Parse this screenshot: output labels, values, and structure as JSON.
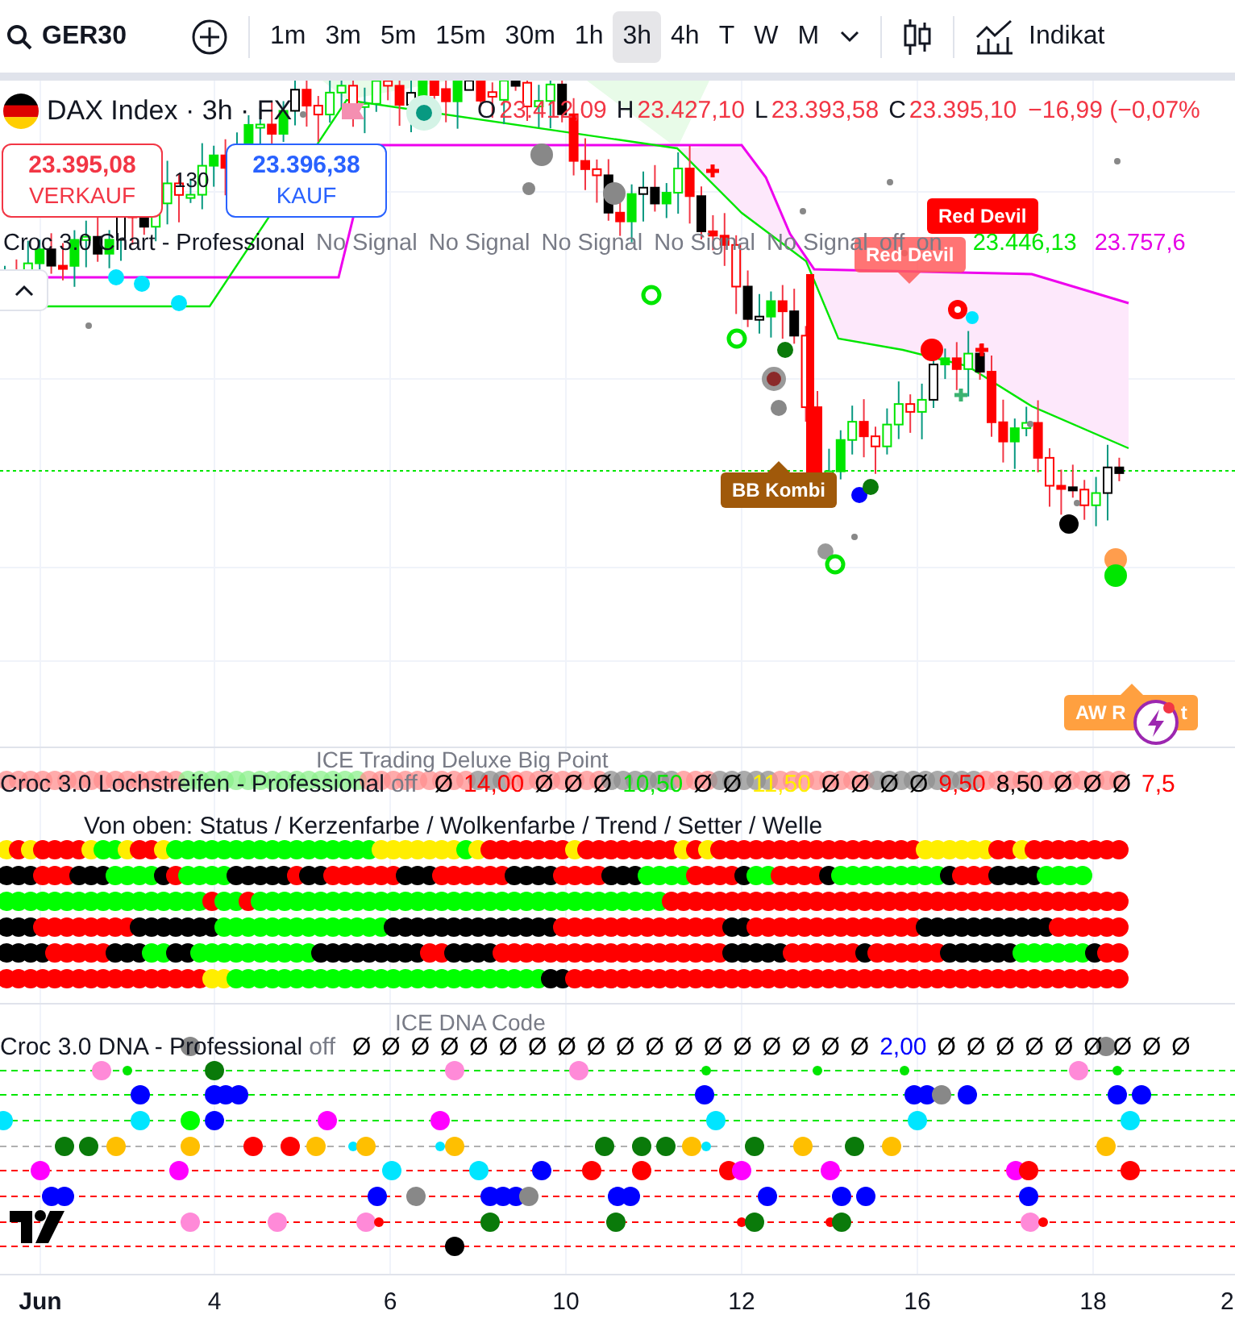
{
  "toolbar": {
    "symbol": "GER30",
    "intervals": [
      {
        "label": "1m",
        "selected": false
      },
      {
        "label": "3m",
        "selected": false
      },
      {
        "label": "5m",
        "selected": false
      },
      {
        "label": "15m",
        "selected": false
      },
      {
        "label": "30m",
        "selected": false
      },
      {
        "label": "1h",
        "selected": false
      },
      {
        "label": "3h",
        "selected": true
      },
      {
        "label": "4h",
        "selected": false
      },
      {
        "label": "T",
        "selected": false
      },
      {
        "label": "W",
        "selected": false
      },
      {
        "label": "M",
        "selected": false
      }
    ],
    "indicators_label": "Indikat"
  },
  "legend": {
    "title": "DAX Index · 3h · FX",
    "ohlc": [
      {
        "key": "O",
        "value": "23.412,09"
      },
      {
        "key": "H",
        "value": "23.427,10"
      },
      {
        "key": "L",
        "value": "23.393,58"
      },
      {
        "key": "C",
        "value": "23.395,10"
      }
    ],
    "change": "−16,99 (−0,07%"
  },
  "sell": {
    "price": "23.395,08",
    "label": "VERKAUF"
  },
  "buy": {
    "price": "23.396,38",
    "label": "KAUF"
  },
  "spread": "130",
  "chart_indicator": {
    "name": "Croc 3.0 Chart - Professional",
    "signals": [
      "No Signal",
      "No Signal",
      "No Signal",
      "No Signal",
      "No Signal"
    ],
    "flags": [
      "off",
      "on"
    ],
    "values": [
      {
        "text": "23.446,13",
        "color": "#00e600"
      },
      {
        "text": "23.757,6",
        "color": "#e600e6"
      }
    ]
  },
  "signal_labels": [
    {
      "kind": "solid",
      "text": "Red Devil"
    },
    {
      "kind": "faded",
      "text": "Red Devil"
    },
    {
      "kind": "kombi",
      "text": "BB Kombi"
    },
    {
      "kind": "rocket",
      "text": "AW R",
      "tail": "t"
    }
  ],
  "lochstreifen": {
    "title": "ICE Trading Deluxe Big Point",
    "name": "Croc 3.0 Lochstreifen - Professional",
    "state": "off",
    "values": [
      {
        "text": "Ø",
        "color": "#000000"
      },
      {
        "text": "14,00",
        "color": "#ff0000"
      },
      {
        "text": "Ø",
        "color": "#000000"
      },
      {
        "text": "Ø",
        "color": "#000000"
      },
      {
        "text": "Ø",
        "color": "#000000"
      },
      {
        "text": "10,50",
        "color": "#00e600"
      },
      {
        "text": "Ø",
        "color": "#000000"
      },
      {
        "text": "Ø",
        "color": "#000000"
      },
      {
        "text": "11,50",
        "color": "#ffee00"
      },
      {
        "text": "Ø",
        "color": "#000000"
      },
      {
        "text": "Ø",
        "color": "#000000"
      },
      {
        "text": "Ø",
        "color": "#000000"
      },
      {
        "text": "Ø",
        "color": "#000000"
      },
      {
        "text": "9,50",
        "color": "#ff0000"
      },
      {
        "text": "8,50",
        "color": "#000000"
      },
      {
        "text": "Ø",
        "color": "#000000"
      },
      {
        "text": "Ø",
        "color": "#000000"
      },
      {
        "text": "Ø",
        "color": "#000000"
      },
      {
        "text": "7,5",
        "color": "#ff0000"
      }
    ],
    "legend": "Von oben: Status / Kerzenfarbe / Wolkenfarbe / Trend / Setter / Welle"
  },
  "dna": {
    "title": "ICE DNA Code",
    "name": "Croc 3.0 DNA - Professional",
    "state": "off",
    "values": [
      {
        "text": "Ø",
        "color": "#000000"
      },
      {
        "text": "Ø",
        "color": "#000000"
      },
      {
        "text": "Ø",
        "color": "#000000"
      },
      {
        "text": "Ø",
        "color": "#000000"
      },
      {
        "text": "Ø",
        "color": "#000000"
      },
      {
        "text": "Ø",
        "color": "#000000"
      },
      {
        "text": "Ø",
        "color": "#000000"
      },
      {
        "text": "Ø",
        "color": "#000000"
      },
      {
        "text": "Ø",
        "color": "#000000"
      },
      {
        "text": "Ø",
        "color": "#000000"
      },
      {
        "text": "Ø",
        "color": "#000000"
      },
      {
        "text": "Ø",
        "color": "#000000"
      },
      {
        "text": "Ø",
        "color": "#000000"
      },
      {
        "text": "Ø",
        "color": "#000000"
      },
      {
        "text": "Ø",
        "color": "#000000"
      },
      {
        "text": "Ø",
        "color": "#000000"
      },
      {
        "text": "Ø",
        "color": "#000000"
      },
      {
        "text": "Ø",
        "color": "#000000"
      },
      {
        "text": "2,00",
        "color": "#0000ff"
      },
      {
        "text": "Ø",
        "color": "#000000"
      },
      {
        "text": "Ø",
        "color": "#000000"
      },
      {
        "text": "Ø",
        "color": "#000000"
      },
      {
        "text": "Ø",
        "color": "#000000"
      },
      {
        "text": "Ø",
        "color": "#000000"
      },
      {
        "text": "Ø",
        "color": "#000000"
      },
      {
        "text": "Ø",
        "color": "#000000"
      },
      {
        "text": "Ø",
        "color": "#000000"
      },
      {
        "text": "Ø",
        "color": "#000000"
      }
    ]
  },
  "x_axis": [
    "Jun",
    "4",
    "6",
    "10",
    "12",
    "16",
    "18",
    "2"
  ]
}
